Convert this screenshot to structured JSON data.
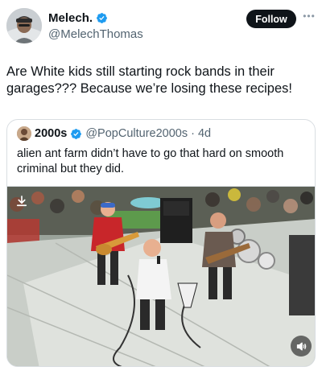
{
  "author": {
    "display_name": "Melech.",
    "handle": "@MelechThomas",
    "verified": true,
    "avatar_icon": "user-avatar"
  },
  "actions": {
    "follow_label": "Follow",
    "more_icon": "more-icon"
  },
  "tweet": {
    "text": "Are White kids still starting rock bands in their\ngarages??? Because we’re losing these recipes!"
  },
  "quote": {
    "display_name": "2000s",
    "handle": "@PopCulture2000s",
    "separator": "·",
    "time": "4d",
    "verified": true,
    "text": "alien ant farm didn’t have to go that hard on smooth\ncriminal but they did.",
    "media": {
      "type": "video",
      "description_icon": "video-thumbnail",
      "download_icon": "download-icon",
      "mute_icon": "volume-icon"
    }
  },
  "colors": {
    "verified": "#1d9bf0",
    "follow_bg": "#0f1419",
    "secondary_text": "#536471",
    "border": "#d9dee2"
  }
}
